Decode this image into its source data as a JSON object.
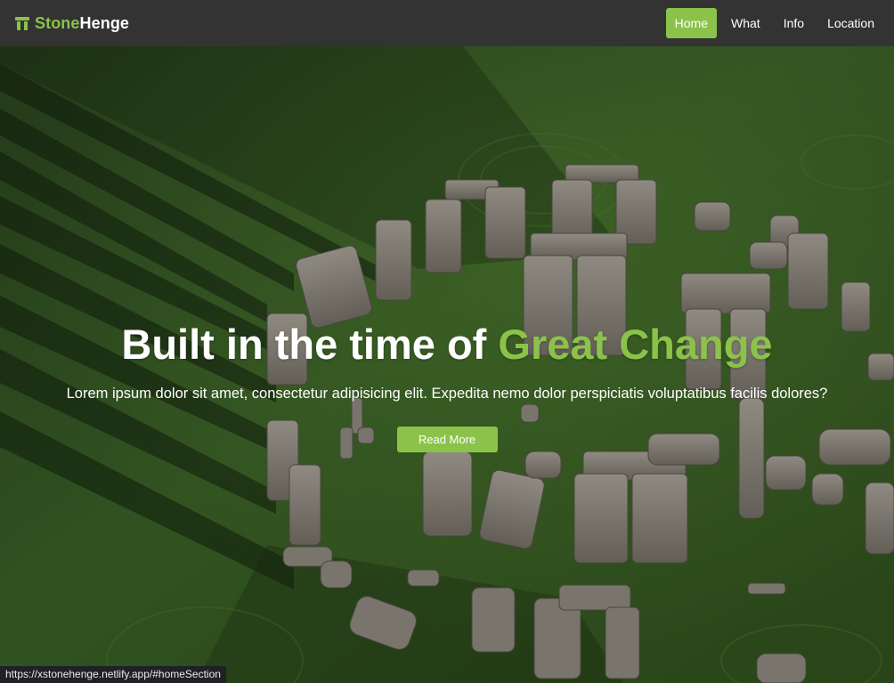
{
  "brand": {
    "icon": "stonehenge-icon",
    "name_part1": "Stone",
    "name_part2": "Henge",
    "color_accent": "#8bc34a"
  },
  "nav": {
    "items": [
      {
        "label": "Home",
        "active": true
      },
      {
        "label": "What",
        "active": false
      },
      {
        "label": "Info",
        "active": false
      },
      {
        "label": "Location",
        "active": false
      }
    ],
    "background": "#333333",
    "active_color": "#8bc34a"
  },
  "hero": {
    "title_plain": "Built in the time of ",
    "title_accent": "Great Change",
    "subtitle": "Lorem ipsum dolor sit amet, consectetur adipisicing elit. Expedita nemo dolor perspiciatis voluptatibus facilis dolores?",
    "button_label": "Read More",
    "background_image": "aerial photo of Stonehenge stone circle on green grass with long shadows"
  },
  "status_bar": {
    "url": "https://xstonehenge.netlify.app/#homeSection"
  }
}
